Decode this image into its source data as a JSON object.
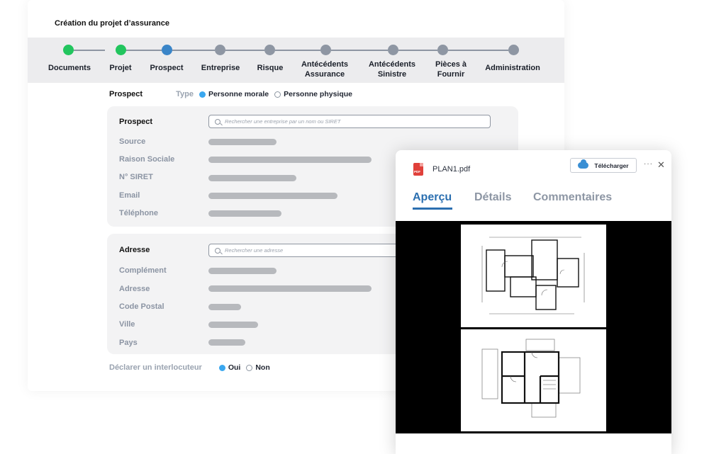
{
  "form": {
    "title": "Création du projet d’assurance",
    "steps": [
      {
        "label": "Documents",
        "status": "done"
      },
      {
        "label": "Projet",
        "status": "done"
      },
      {
        "label": "Prospect",
        "status": "active"
      },
      {
        "label": "Entreprise",
        "status": "pending"
      },
      {
        "label": "Risque",
        "status": "pending"
      },
      {
        "label": "Antécédents Assurance",
        "line1": "Antécédents",
        "line2": "Assurance",
        "status": "pending"
      },
      {
        "label": "Antécédents Sinistre",
        "line1": "Antécédents",
        "line2": "Sinistre",
        "status": "pending"
      },
      {
        "label": "Pièces à Fournir",
        "line1": "Pièces à",
        "line2": "Fournir",
        "status": "pending"
      },
      {
        "label": "Administration",
        "status": "pending"
      }
    ],
    "type_row": {
      "title": "Prospect",
      "type_label": "Type",
      "option_selected": "Personne morale",
      "option_other": "Personne physique"
    },
    "prospect": {
      "title": "Prospect",
      "search_placeholder": "Rechercher une entreprise par un nom ou SIRET",
      "fields": [
        "Source",
        "Raison Sociale",
        "N° SIRET",
        "Email",
        "Téléphone"
      ]
    },
    "adresse": {
      "title": "Adresse",
      "search_placeholder": "Rechercher une adresse",
      "fields": [
        "Complément",
        "Adresse",
        "Code Postal",
        "Ville",
        "Pays"
      ]
    },
    "declare": {
      "label": "Déclarer un interlocuteur",
      "yes": "Oui",
      "no": "Non"
    }
  },
  "preview": {
    "file_icon_text": "PDF",
    "file_name": "PLAN1.pdf",
    "download_label": "Télécharger",
    "more_glyph": "···",
    "close_glyph": "✕",
    "tabs": [
      "Aperçu",
      "Détails",
      "Commentaires"
    ],
    "active_tab": "Aperçu"
  },
  "colors": {
    "done": "#22c55e",
    "active": "#3a85c8",
    "pending": "#8e96a3",
    "accent": "#2b6fb0",
    "radio_on": "#3aa7ef"
  }
}
